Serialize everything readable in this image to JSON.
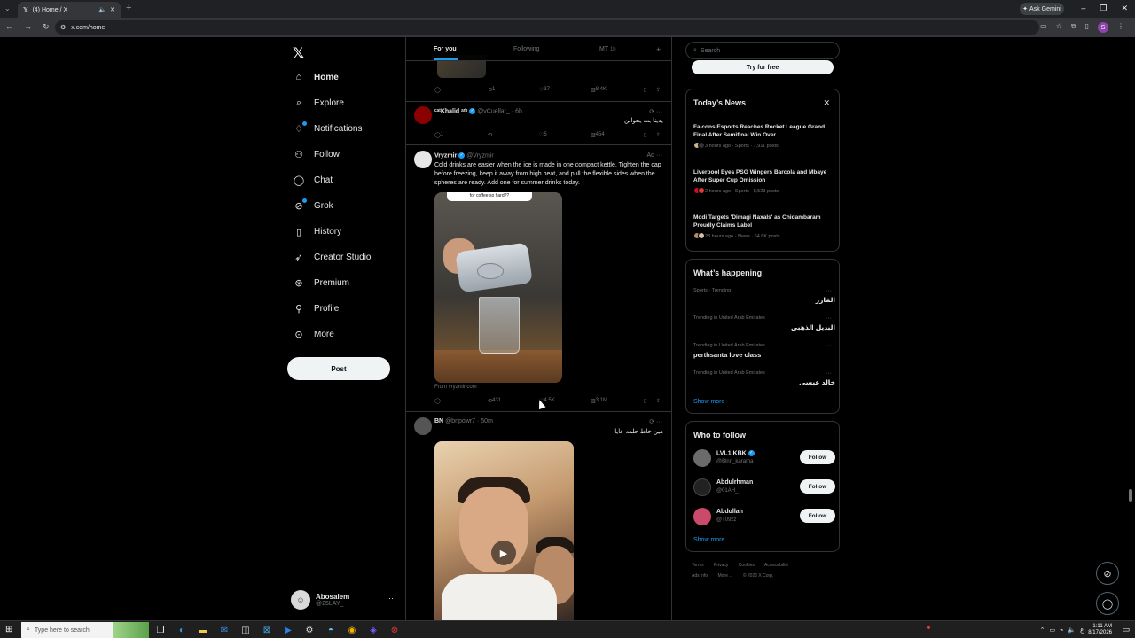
{
  "browser": {
    "tab_title": "(4) Home / X",
    "url": "x.com/home",
    "gemini_label": "Ask Gemini",
    "profile_initial": "S"
  },
  "nav": {
    "items": [
      {
        "label": "Home",
        "icon": "home-icon"
      },
      {
        "label": "Explore",
        "icon": "search-icon"
      },
      {
        "label": "Notifications",
        "icon": "bell-icon"
      },
      {
        "label": "Follow",
        "icon": "person-add-icon"
      },
      {
        "label": "Chat",
        "icon": "chat-icon"
      },
      {
        "label": "Grok",
        "icon": "grok-icon"
      },
      {
        "label": "History",
        "icon": "bookmark-icon"
      },
      {
        "label": "Creator Studio",
        "icon": "rocket-icon"
      },
      {
        "label": "Premium",
        "icon": "premium-icon"
      },
      {
        "label": "Profile",
        "icon": "profile-icon"
      },
      {
        "label": "More",
        "icon": "more-icon"
      }
    ],
    "post_label": "Post",
    "account": {
      "name": "Abosalem",
      "handle": "@25LAY_"
    }
  },
  "timeline": {
    "tabs": {
      "for_you": "For you",
      "following": "Following",
      "mt": "MT",
      "mt_age": "1h"
    },
    "post0": {
      "replies": "",
      "reposts": "1",
      "likes": "37",
      "views": "8.4K"
    },
    "post1": {
      "name": "ᶜᵃᵗKhalid ᵃʳᵇ",
      "handle": "@vCuellar_",
      "time": "6h",
      "text": "يدينا بت يحوالن",
      "replies": "1",
      "reposts": "",
      "likes": "5",
      "views": "454"
    },
    "ad": {
      "name": "Vryzmir",
      "handle": "@Vryzmir",
      "ad_label": "Ad",
      "text": "Cold drinks are easier when the ice is made in one compact kettle. Tighten the cap before freezing, keep it away from high heat, and pull the flexible sides when the spheres are ready. Add one for summer drinks today.",
      "media_caption": "for coffee so hard??",
      "from": "From vryzmir.com",
      "replies": "",
      "reposts": "431",
      "likes": "4.5K",
      "views": "3.1M"
    },
    "post3": {
      "name": "BN",
      "handle": "@bnpowr7",
      "time": "50m",
      "text": "مين خاط حلمه عايا"
    }
  },
  "sidebar": {
    "search_placeholder": "Search",
    "try_free": "Try for free",
    "news": {
      "title": "Today’s News",
      "items": [
        {
          "headline": "Falcons Esports Reaches Rocket League Grand Final After Semifinal Win Over ...",
          "meta": "3 hours ago · Sports · 7,911 posts"
        },
        {
          "headline": "Liverpool Eyes PSG Wingers Barcola and Mbaye After Super Cup Omission",
          "meta": "2 hours ago · Sports · 8,523 posts"
        },
        {
          "headline": "Modi Targets 'Dimagi Naxals' as Chidambaram Proudly Claims Label",
          "meta": "23 hours ago · News · 64.8K posts"
        }
      ]
    },
    "happening": {
      "title": "What’s happening",
      "trends": [
        {
          "context": "Sports · Trending",
          "name": "الفارز"
        },
        {
          "context": "Trending in United Arab Emirates",
          "name": "البديل الذهبي"
        },
        {
          "context": "Trending in United Arab Emirates",
          "name": "perthsanta love class"
        },
        {
          "context": "Trending in United Arab Emirates",
          "name": "خالد عيسى"
        }
      ],
      "show_more": "Show more"
    },
    "who_to_follow": {
      "title": "Who to follow",
      "users": [
        {
          "name": "LVL1 KBK",
          "handle": "@Blnn_karama",
          "button": "Follow"
        },
        {
          "name": "Abdulrhman",
          "handle": "@01AH_",
          "button": "Follow"
        },
        {
          "name": "Abdullah",
          "handle": "@T09zz",
          "button": "Follow"
        }
      ],
      "show_more": "Show more"
    },
    "footer": {
      "links": [
        "Terms",
        "Privacy",
        "Cookies",
        "Accessibility",
        "Ads info",
        "More ...",
        "© 2026 X Corp."
      ]
    }
  },
  "taskbar": {
    "search_placeholder": "Type here to search",
    "time": "1:11 AM",
    "date": "8/17/2026"
  },
  "colors": {
    "accent": "#1d9bf0",
    "background": "#000000",
    "border": "#2f3336",
    "muted": "#71767b"
  }
}
